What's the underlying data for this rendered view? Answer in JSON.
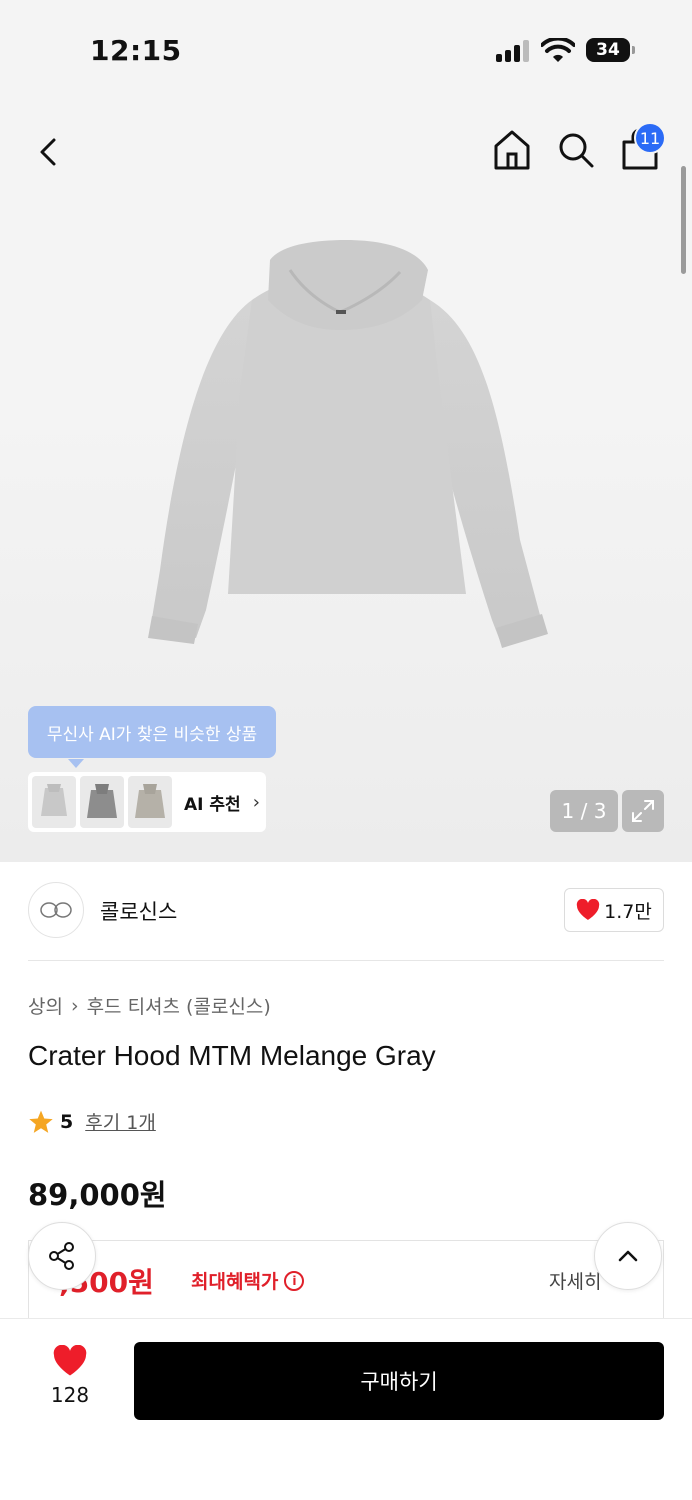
{
  "status_bar": {
    "time": "12:15",
    "battery": "34",
    "battery_level": 0.34
  },
  "nav": {
    "cart_count": "11"
  },
  "gallery": {
    "ai_tooltip": "무신사 AI가 찾은 비슷한 상품",
    "ai_recommend_label": "AI 추천",
    "page_indicator": "1 / 3"
  },
  "brand": {
    "name": "콜로신스",
    "likes": "1.7만"
  },
  "breadcrumb": {
    "category": "상의",
    "subcategory": "후드 티셔츠 (콜로신스)"
  },
  "product": {
    "title": "Crater Hood MTM Melange Gray",
    "rating": "5",
    "reviews": "후기 1개",
    "price": "89,000원"
  },
  "benefit": {
    "price": ",500원",
    "label": "최대혜택가",
    "detail": "자세히"
  },
  "bottom_bar": {
    "wish_count": "128",
    "buy_label": "구매하기"
  },
  "colors": {
    "accent_blue": "#2b6bf6",
    "sale_red": "#e0202a",
    "heart_red": "#ee1d2a",
    "star": "#f5a623"
  }
}
